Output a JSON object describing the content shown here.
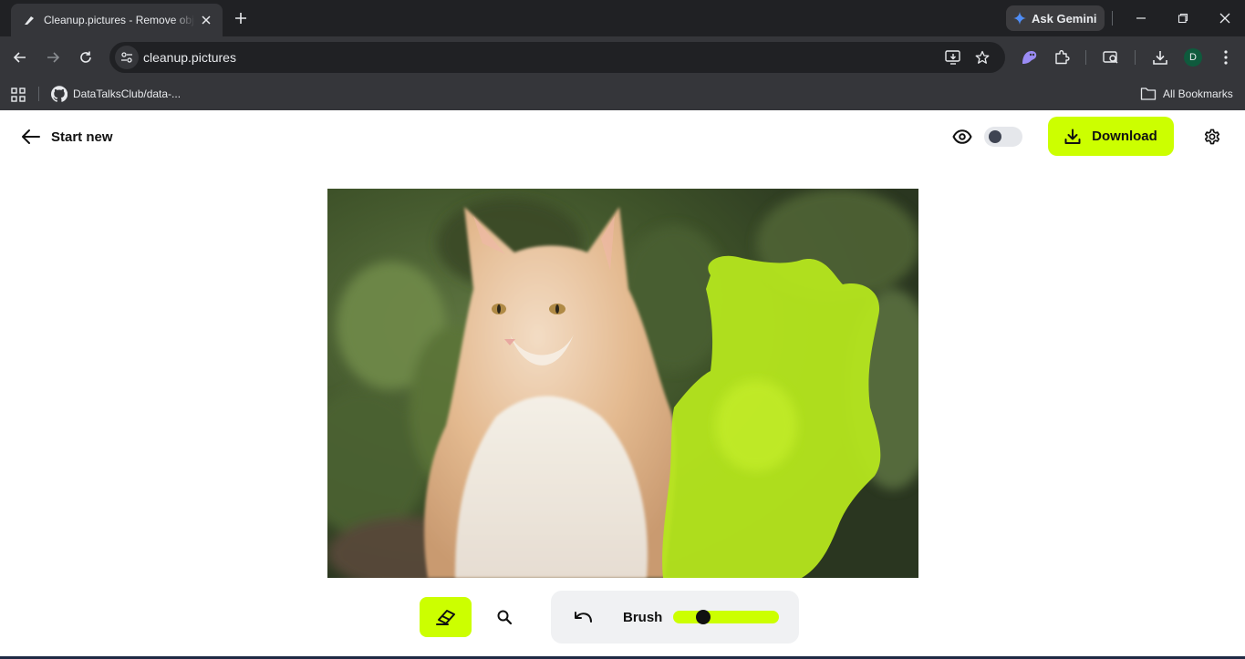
{
  "browser": {
    "tab_title": "Cleanup.pictures - Remove objects",
    "url": "cleanup.pictures",
    "ask_gemini_label": "Ask Gemini",
    "profile_initial": "D",
    "bookmarks": [
      {
        "label": "DataTalksClub/data-...",
        "icon": "github-icon"
      }
    ],
    "all_bookmarks_label": "All Bookmarks"
  },
  "app": {
    "start_new_label": "Start new",
    "download_label": "Download",
    "compare_toggle_on": false,
    "tools": {
      "active_tool": "eraser",
      "brush_label": "Brush",
      "brush_size_fraction": 0.25
    },
    "accent_color": "#ccff00",
    "mask_color": "#b5e61d"
  }
}
